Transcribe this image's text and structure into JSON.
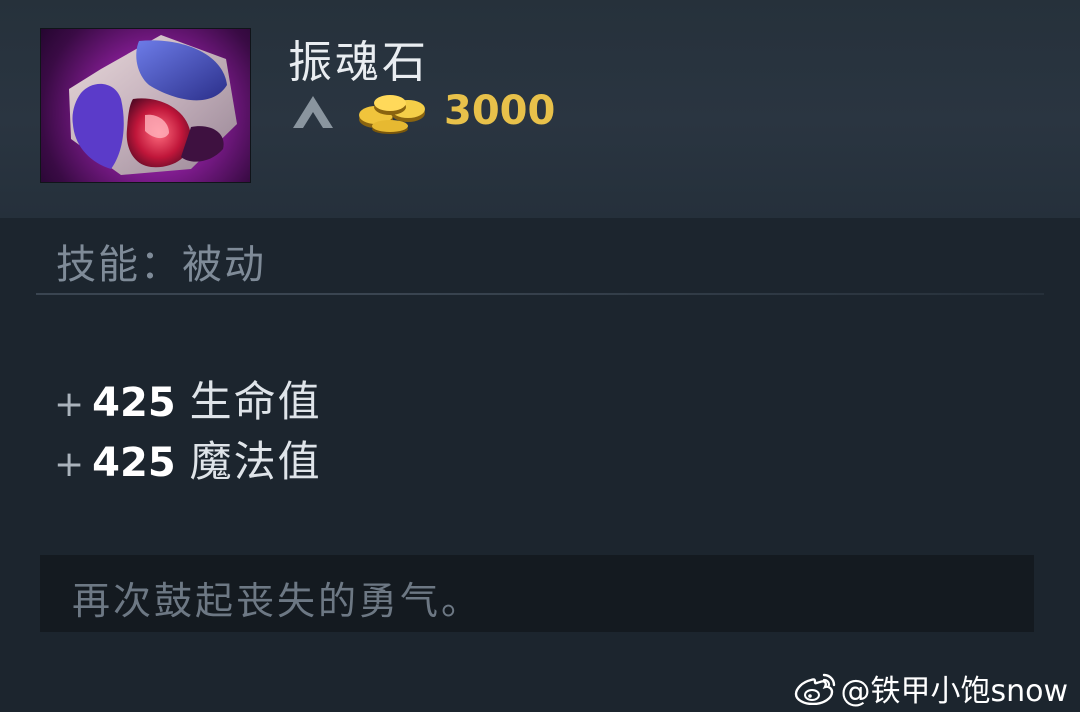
{
  "item": {
    "name": "振魂石",
    "price": "3000",
    "ability_label": "技能：被动",
    "lore": "再次鼓起丧失的勇气。",
    "icon": "soul-booster-item-icon"
  },
  "stats": [
    {
      "plus": "+",
      "value": "425",
      "name": "生命值"
    },
    {
      "plus": "+",
      "value": "425",
      "name": "魔法值"
    }
  ],
  "watermark": {
    "text": "@铁甲小饱snow",
    "icon": "weibo-icon"
  },
  "colors": {
    "price": "#e8c14a",
    "background": "#1c252e",
    "header": "#2a3541"
  }
}
